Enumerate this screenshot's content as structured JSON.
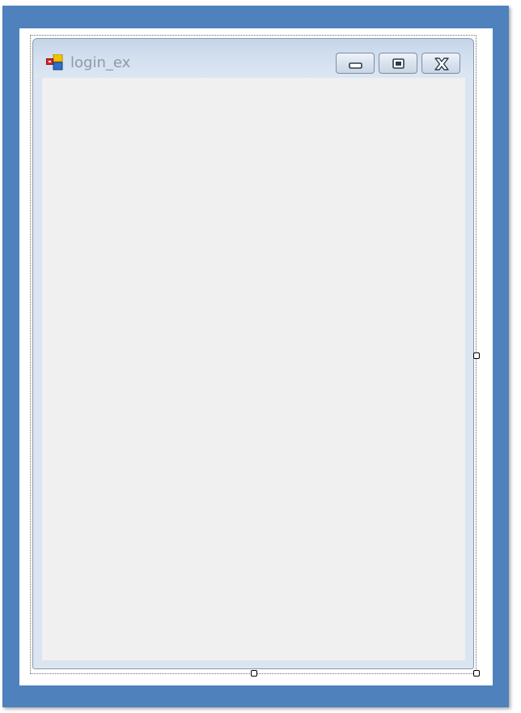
{
  "window": {
    "title": "login_ex",
    "icon": "winforms-form-icon",
    "controls": [
      "minimize-icon",
      "maximize-icon",
      "close-icon"
    ]
  },
  "colors": {
    "frame": "#4f81bd",
    "window_border": "#dbe5f1",
    "client": "#f0f0f0",
    "title_text": "#8f9aa7"
  }
}
